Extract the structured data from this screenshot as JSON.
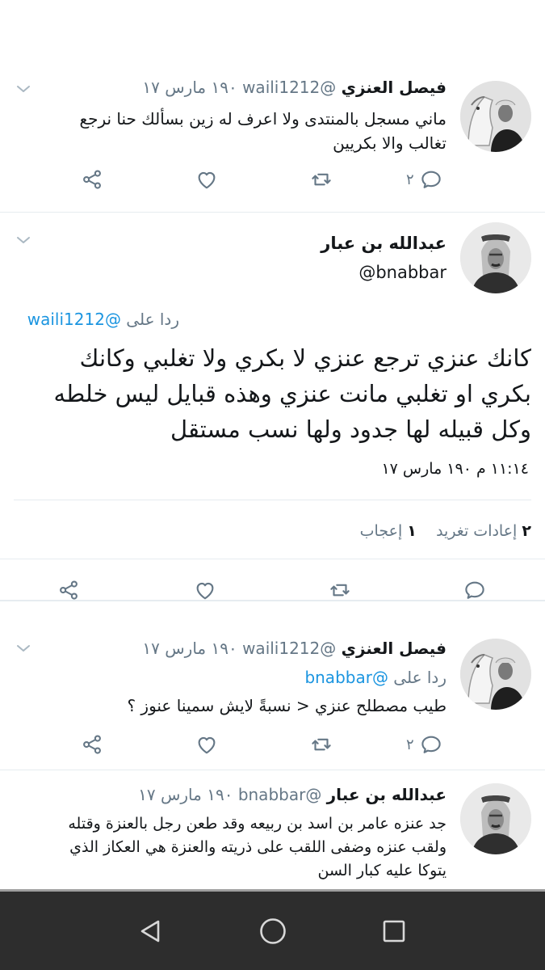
{
  "tweets": [
    {
      "name": "فيصل العنزي",
      "handle": "@waili1212",
      "date": "١٩٠ مارس ١٧",
      "lines": [
        "ماني مسجل بالمنتدى ولا اعرف له زين بسألك حنا نرجع",
        "تغالب والا بكريين"
      ],
      "reply_count": "٢"
    },
    {
      "name": "فيصل العنزي",
      "handle": "@waili1212",
      "date": "١٩٠ مارس ١٧",
      "reply_prefix": "ردا على",
      "reply_to": "@bnabbar",
      "lines": [
        "طيب مصطلح عنزي < نسبةً لايش سمينا عنوز ؟"
      ],
      "reply_count": "٢"
    },
    {
      "name": "عبدالله بن عبار",
      "handle": "@bnabbar",
      "date": "١٩٠ مارس ١٧",
      "lines": [
        "جد عنزه عامر بن اسد بن ربيعه وقد طعن رجل بالعنزة وقتله",
        "ولقب عنزه وضفى اللقب على ذريته والعنزة هي العكاز الذي",
        "يتوكا عليه كبار السن"
      ]
    }
  ],
  "main_tweet": {
    "name": "عبدالله بن عبار",
    "handle": "@bnabbar",
    "reply_prefix": "ردا على",
    "reply_to": "@waili1212",
    "lines": [
      "كانك عنزي ترجع عنزي لا بكري ولا تغلبي وكانك",
      "بكري او تغلبي مانت عنزي وهذه قبايل ليس خلطه",
      "وكل قبيله لها جدود ولها نسب مستقل"
    ],
    "timestamp": "١١:١٤ م ١٩٠ مارس ١٧",
    "stats": {
      "retweets_count": "٢",
      "retweets_label": "إعادات تغريد",
      "likes_count": "١",
      "likes_label": "إعجاب"
    }
  },
  "icons": {
    "reply": "reply-icon",
    "retweet": "retweet-icon",
    "like": "like-icon",
    "share": "share-icon",
    "more": "chevron-down-icon",
    "nav_back": "nav-back-icon",
    "nav_home": "nav-home-icon",
    "nav_recents": "nav-recents-icon"
  },
  "colors": {
    "link": "#1b95e0",
    "muted": "#657786",
    "navbar": "#2d2d2d"
  }
}
